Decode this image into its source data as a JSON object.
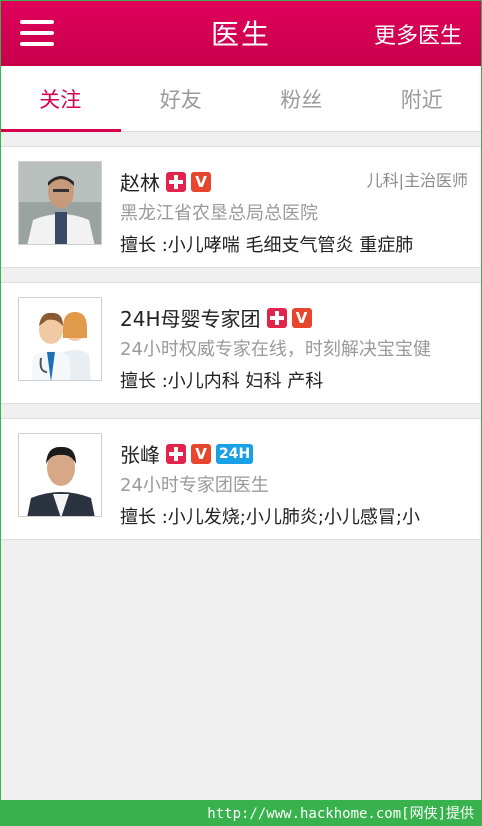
{
  "header": {
    "title": "医生",
    "more_label": "更多医生"
  },
  "tabs": [
    {
      "label": "关注",
      "active": true
    },
    {
      "label": "好友",
      "active": false
    },
    {
      "label": "粉丝",
      "active": false
    },
    {
      "label": "附近",
      "active": false
    }
  ],
  "doctors": [
    {
      "name": "赵林",
      "badges": [
        "cross-icon",
        "v-icon"
      ],
      "role": "儿科|主治医师",
      "org": "黑龙江省农垦总局总医院",
      "skill": "擅长 :小儿哮喘  毛细支气管炎  重症肺"
    },
    {
      "name": "24H母婴专家团",
      "badges": [
        "cross-icon",
        "v-icon"
      ],
      "role": "",
      "org": "24小时权威专家在线，时刻解决宝宝健",
      "skill": "擅长 :小儿内科 妇科 产科"
    },
    {
      "name": "张峰",
      "badges": [
        "cross-icon",
        "v-icon",
        "24h-icon"
      ],
      "badge_24_label": "24H",
      "role": "",
      "org": "24小时专家团医生",
      "skill": "擅长 :小儿发烧;小儿肺炎;小儿感冒;小"
    }
  ],
  "watermark": "http://www.hackhome.com[网侠]提供",
  "colors": {
    "primary": "#d6004f",
    "watermark": "#37b24d",
    "v_badge": "#e8462c",
    "badge_24": "#1aa0e6"
  }
}
